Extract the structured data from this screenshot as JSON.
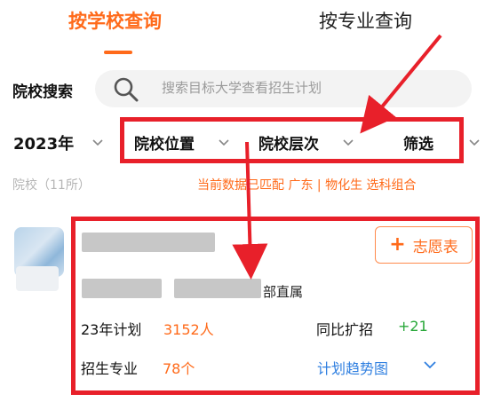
{
  "tabs": [
    {
      "label": "按学校查询",
      "active": true
    },
    {
      "label": "按专业查询",
      "active": false
    }
  ],
  "search": {
    "label": "院校搜索",
    "placeholder": "搜索目标大学查看招生计划"
  },
  "filters": {
    "year": "2023年",
    "location": "院校位置",
    "level": "院校层次",
    "screen": "筛选"
  },
  "info": {
    "count_text": "院校（11所）",
    "match_note": "当前数据已匹配 广东 | 物化生 选科组合"
  },
  "card": {
    "dept_suffix": "部直属",
    "add_button": "志愿表",
    "plan_label": "23年计划",
    "plan_value": "3152人",
    "expand_label": "同比扩招",
    "expand_value": "+21",
    "major_label": "招生专业",
    "major_value": "78个",
    "trend_link": "计划趋势图"
  },
  "colors": {
    "accent": "#ff6a1a",
    "highlight_box": "#e8202a",
    "positive": "#29a83a",
    "link": "#2f7fe0"
  }
}
